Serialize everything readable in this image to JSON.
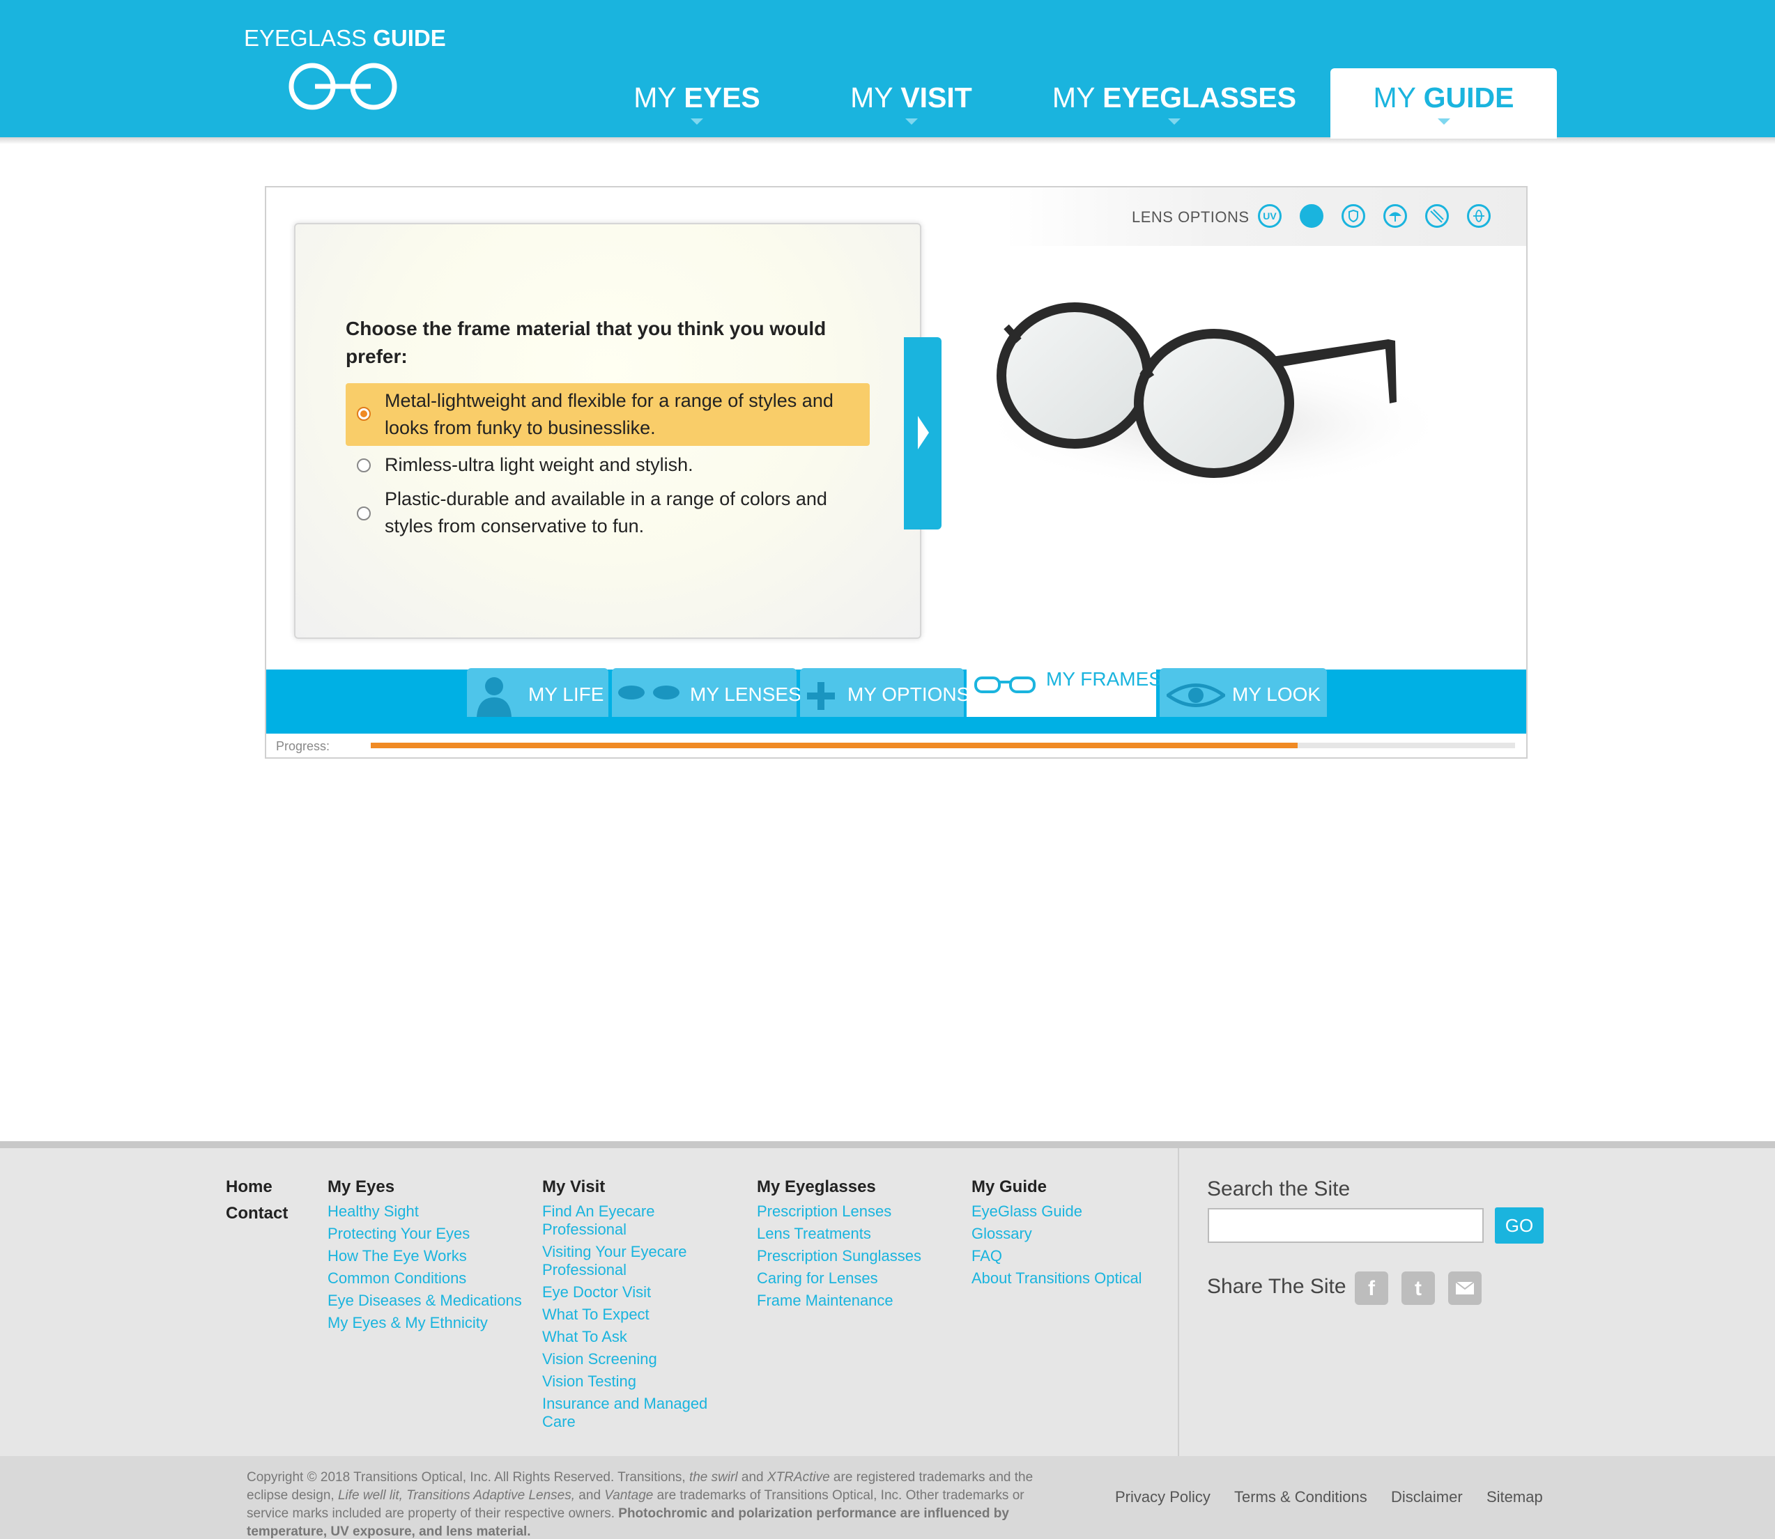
{
  "header": {
    "logo_light": "EYEGLASS",
    "logo_bold": "GUIDE",
    "nav": [
      {
        "pre": "MY",
        "main": "EYES"
      },
      {
        "pre": "MY",
        "main": "VISIT"
      },
      {
        "pre": "MY",
        "main": "EYEGLASSES"
      },
      {
        "pre": "MY",
        "main": "GUIDE"
      }
    ]
  },
  "lens_options": {
    "label": "LENS OPTIONS",
    "icons": [
      "uv-icon",
      "tint-icon",
      "shield-icon",
      "umbrella-icon",
      "scratch-icon",
      "globe-icon"
    ],
    "uv_text": "UV"
  },
  "question": {
    "text": "Choose the frame material that you think you would prefer:",
    "options": [
      {
        "label": "Metal-lightweight and flexible for a range of styles and looks from funky to businesslike.",
        "selected": true
      },
      {
        "label": "Rimless-ultra light weight and stylish.",
        "selected": false
      },
      {
        "label": "Plastic-durable and available in a range of colors and styles from conservative to fun.",
        "selected": false
      }
    ]
  },
  "tabs": [
    {
      "label": "MY LIFE",
      "icon": "person-icon"
    },
    {
      "label": "MY LENSES",
      "icon": "lenses-icon"
    },
    {
      "label": "MY OPTIONS",
      "icon": "plus-icon"
    },
    {
      "label": "MY FRAMES",
      "icon": "frames-icon",
      "active": true
    },
    {
      "label": "MY LOOK",
      "icon": "eye-icon"
    }
  ],
  "progress": {
    "label": "Progress:",
    "value": 0.81
  },
  "colors": {
    "brand": "#1ab4de",
    "accent": "#f08a24",
    "selected_option": "#f9cd69"
  },
  "footer": {
    "home": "Home",
    "contact": "Contact",
    "columns": [
      {
        "title": "My Eyes",
        "links": [
          "Healthy Sight",
          "Protecting Your Eyes",
          "How The Eye Works",
          "Common Conditions",
          "Eye Diseases & Medications",
          "My Eyes & My Ethnicity"
        ]
      },
      {
        "title": "My Visit",
        "links": [
          "Find An Eyecare Professional",
          "Visiting Your Eyecare Professional",
          "Eye Doctor Visit",
          "What To Expect",
          "What To Ask",
          "Vision Screening",
          "Vision Testing",
          "Insurance and Managed Care"
        ]
      },
      {
        "title": "My Eyeglasses",
        "links": [
          "Prescription Lenses",
          "Lens Treatments",
          "Prescription Sunglasses",
          "Caring for Lenses",
          "Frame Maintenance"
        ]
      },
      {
        "title": "My Guide",
        "links": [
          "EyeGlass Guide",
          "Glossary",
          "FAQ",
          "About Transitions Optical"
        ]
      }
    ],
    "search_title": "Search the Site",
    "search_placeholder": "",
    "go_label": "GO",
    "share_title": "Share The Site",
    "share_icons": [
      "facebook-icon",
      "twitter-icon",
      "email-icon"
    ],
    "copyright_1": "Copyright © 2018 Transitions Optical, Inc. All Rights Reserved. Transitions, ",
    "copyright_swirl": "the swirl",
    "copyright_2": " and ",
    "copyright_xtr": "XTRActive",
    "copyright_3": " are registered trademarks and the eclipse design, ",
    "copyright_life": "Life well lit, Transitions Adaptive Lenses,",
    "copyright_4": " and ",
    "copyright_vantage": "Vantage",
    "copyright_5": " are trademarks of Transitions Optical, Inc. Other trademarks or service marks included are property of their respective owners. ",
    "copyright_bold": "Photochromic and polarization performance are influenced by temperature, UV exposure, and lens material.",
    "legal": [
      "Privacy Policy",
      "Terms & Conditions",
      "Disclaimer",
      "Sitemap"
    ]
  }
}
